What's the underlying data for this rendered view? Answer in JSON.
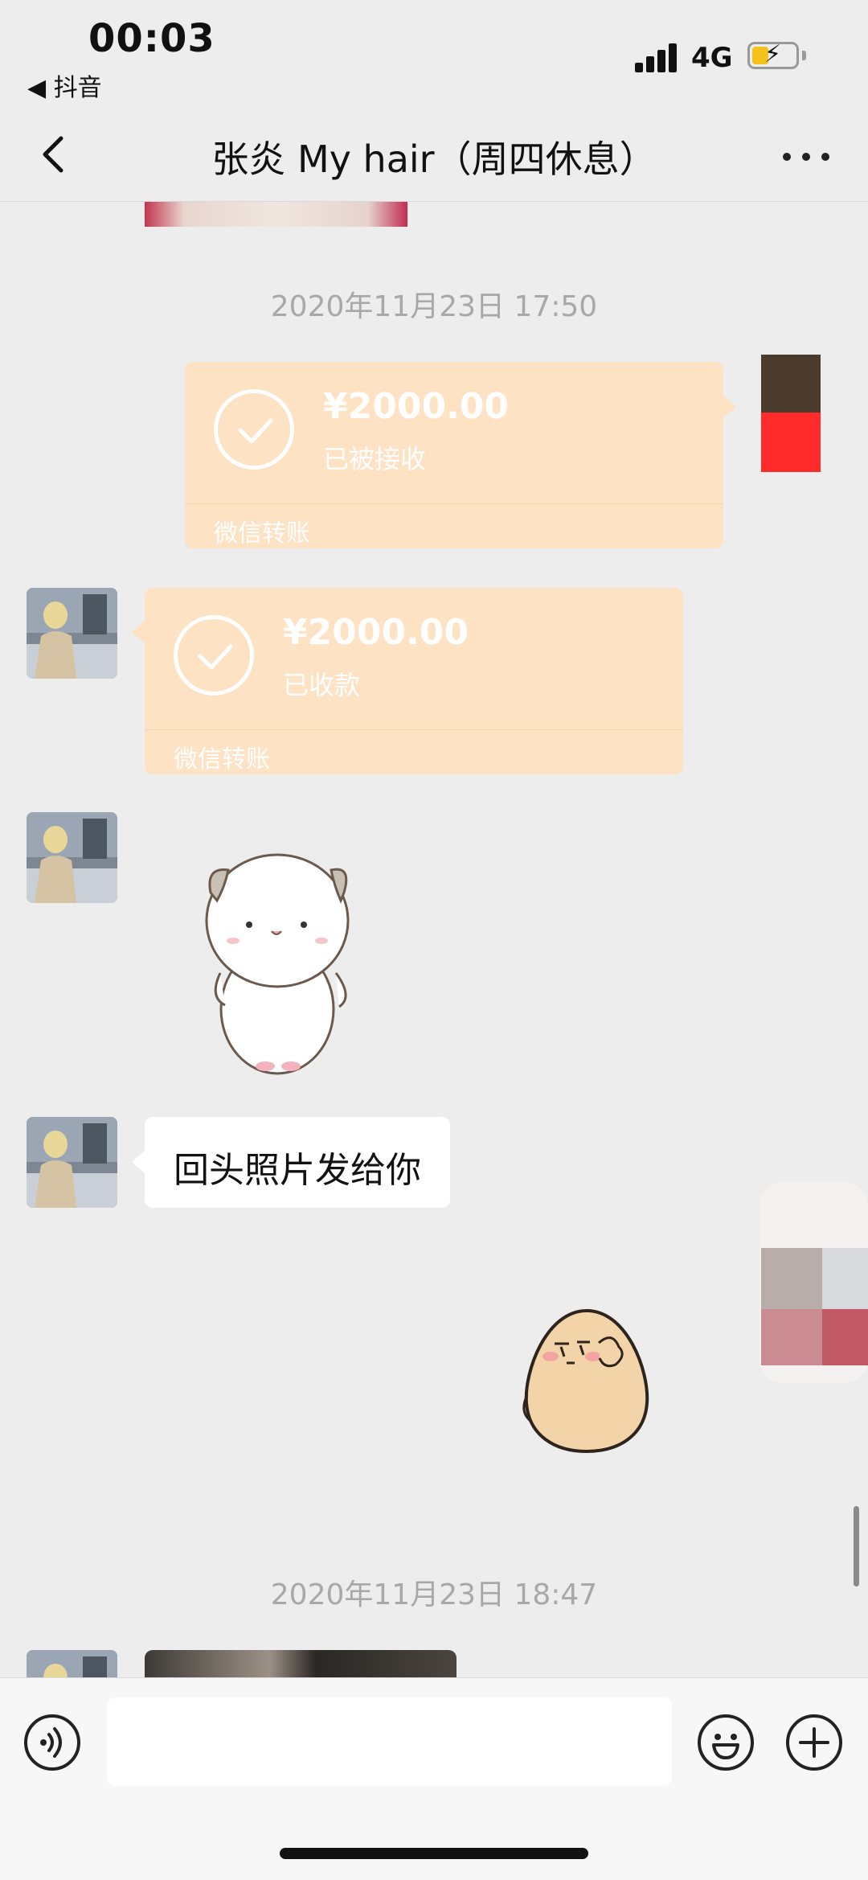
{
  "status_bar": {
    "time": "00:03",
    "back_app": "◀ 抖音",
    "network": "4G"
  },
  "header": {
    "title": "张炎 My hair（周四休息）"
  },
  "chat": {
    "timestamp_1": "2020年11月23日 17:50",
    "transfer_sent": {
      "amount": "¥2000.00",
      "status": "已被接收",
      "footer": "微信转账"
    },
    "transfer_received": {
      "amount": "¥2000.00",
      "status": "已收款",
      "footer": "微信转账"
    },
    "text_message": "回头照片发给你",
    "timestamp_2": "2020年11月23日 18:47"
  },
  "colors": {
    "background": "#ededed",
    "transfer_bubble": "#fde2c4",
    "text_bubble": "#ffffff",
    "timestamp": "#a8a8a8"
  },
  "icons": [
    "back-arrow-icon",
    "more-dots-icon",
    "voice-icon",
    "emoji-icon",
    "plus-icon",
    "check-circle-icon"
  ]
}
